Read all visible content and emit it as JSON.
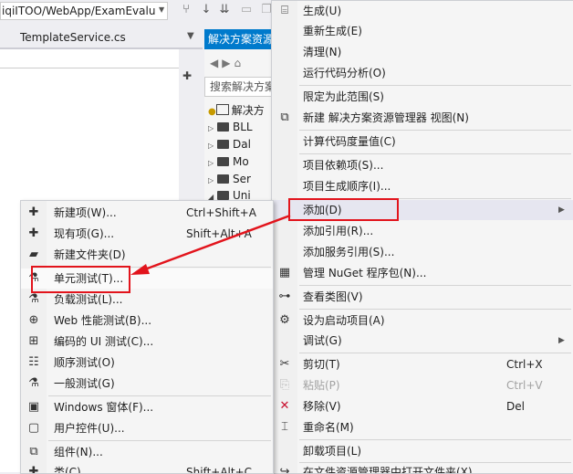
{
  "toolbar": {
    "path": "iqiITOO/WebApp/ExamEvalu",
    "icons": [
      "merge-icon",
      "pull-icon",
      "sort-icon",
      "layout-icon",
      "copy-icon"
    ]
  },
  "tabs": {
    "editor_tab": "TemplateService.cs",
    "sln_tab": "解决方案资源"
  },
  "solution_explorer": {
    "search_placeholder": "搜索解决方案",
    "root": "解决方",
    "items": [
      "BLL",
      "Dal",
      "Mo",
      "Ser",
      "Uni"
    ]
  },
  "context_menu": {
    "items": [
      {
        "label": "生成(U)",
        "shortcut": "",
        "icon": "build-icon"
      },
      {
        "label": "重新生成(E)",
        "shortcut": "",
        "icon": ""
      },
      {
        "label": "清理(N)",
        "shortcut": "",
        "icon": ""
      },
      {
        "label": "运行代码分析(O)",
        "shortcut": "",
        "icon": ""
      },
      {
        "label": "限定为此范围(S)",
        "shortcut": "",
        "icon": ""
      },
      {
        "label": "新建 解决方案资源管理器 视图(N)",
        "shortcut": "",
        "icon": "new-view-icon"
      },
      {
        "label": "计算代码度量值(C)",
        "shortcut": "",
        "icon": ""
      },
      {
        "label": "项目依赖项(S)...",
        "shortcut": "",
        "icon": ""
      },
      {
        "label": "项目生成顺序(I)...",
        "shortcut": "",
        "icon": ""
      },
      {
        "label": "添加(D)",
        "shortcut": "",
        "icon": ""
      },
      {
        "label": "添加引用(R)...",
        "shortcut": "",
        "icon": ""
      },
      {
        "label": "添加服务引用(S)...",
        "shortcut": "",
        "icon": ""
      },
      {
        "label": "管理 NuGet 程序包(N)...",
        "shortcut": "",
        "icon": "nuget-icon"
      },
      {
        "label": "查看类图(V)",
        "shortcut": "",
        "icon": "class-diagram-icon"
      },
      {
        "label": "设为启动项目(A)",
        "shortcut": "",
        "icon": "gear-icon"
      },
      {
        "label": "调试(G)",
        "shortcut": "",
        "icon": ""
      },
      {
        "label": "剪切(T)",
        "shortcut": "Ctrl+X",
        "icon": "cut-icon"
      },
      {
        "label": "粘贴(P)",
        "shortcut": "Ctrl+V",
        "icon": "paste-icon"
      },
      {
        "label": "移除(V)",
        "shortcut": "Del",
        "icon": "remove-icon"
      },
      {
        "label": "重命名(M)",
        "shortcut": "",
        "icon": "rename-icon"
      },
      {
        "label": "卸载项目(L)",
        "shortcut": "",
        "icon": ""
      },
      {
        "label": "在文件资源管理器中打开文件夹(X)",
        "shortcut": "",
        "icon": "open-folder-icon"
      }
    ]
  },
  "add_submenu": {
    "items": [
      {
        "label": "新建项(W)...",
        "shortcut": "Ctrl+Shift+A"
      },
      {
        "label": "现有项(G)...",
        "shortcut": "Shift+Alt+A"
      },
      {
        "label": "新建文件夹(D)",
        "shortcut": ""
      },
      {
        "label": "单元测试(T)...",
        "shortcut": ""
      },
      {
        "label": "负载测试(L)...",
        "shortcut": ""
      },
      {
        "label": "Web 性能测试(B)...",
        "shortcut": ""
      },
      {
        "label": "编码的 UI 测试(C)...",
        "shortcut": ""
      },
      {
        "label": "顺序测试(O)",
        "shortcut": ""
      },
      {
        "label": "一般测试(G)",
        "shortcut": ""
      },
      {
        "label": "Windows 窗体(F)...",
        "shortcut": ""
      },
      {
        "label": "用户控件(U)...",
        "shortcut": ""
      },
      {
        "label": "组件(N)...",
        "shortcut": ""
      },
      {
        "label": "类(C)...",
        "shortcut": "Shift+Alt+C"
      }
    ]
  },
  "colors": {
    "accent": "#007acc",
    "annotation_red": "#e2141c",
    "menu_bg": "#f5f5f5"
  }
}
